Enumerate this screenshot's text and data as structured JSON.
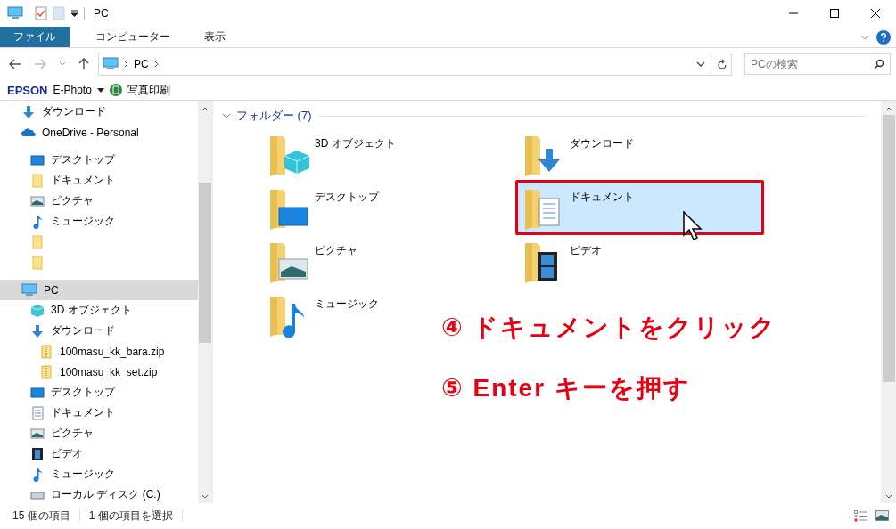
{
  "window": {
    "title": "PC"
  },
  "ribbon": {
    "tabs": [
      {
        "label": "ファイル",
        "selected": true
      },
      {
        "label": "コンピューター",
        "selected": false
      },
      {
        "label": "表示",
        "selected": false
      }
    ]
  },
  "address": {
    "path": [
      "PC"
    ]
  },
  "search": {
    "placeholder": "PCの検索"
  },
  "epson_toolbar": {
    "brand": "EPSON",
    "app": "E-Photo",
    "action": "写真印刷"
  },
  "sidebar": {
    "items": [
      {
        "kind": "download",
        "label": "ダウンロード",
        "selected": false
      },
      {
        "kind": "onedrive",
        "label": "OneDrive - Personal",
        "selected": false,
        "children": [
          {
            "kind": "desktop",
            "label": "デスクトップ",
            "selected": false
          },
          {
            "kind": "folder",
            "label": "ドキュメント",
            "selected": false
          },
          {
            "kind": "pictures",
            "label": "ピクチャ",
            "selected": false
          },
          {
            "kind": "music",
            "label": "ミュージック",
            "selected": false
          },
          {
            "kind": "folder",
            "selected": false
          },
          {
            "kind": "folder",
            "selected": false
          }
        ]
      },
      {
        "kind": "pc",
        "label": "PC",
        "selected": true,
        "children": [
          {
            "kind": "cube",
            "label": "3D オブジェクト",
            "selected": false
          },
          {
            "kind": "download",
            "label": "ダウンロード",
            "selected": false,
            "children": [
              {
                "kind": "zip",
                "label": "100masu_kk_bara.zip",
                "selected": false
              },
              {
                "kind": "zip",
                "label": "100masu_kk_set.zip",
                "selected": false
              }
            ]
          },
          {
            "kind": "desktop",
            "label": "デスクトップ",
            "selected": false
          },
          {
            "kind": "document",
            "label": "ドキュメント",
            "selected": false
          },
          {
            "kind": "pictures",
            "label": "ピクチャ",
            "selected": false
          },
          {
            "kind": "video",
            "label": "ビデオ",
            "selected": false
          },
          {
            "kind": "music",
            "label": "ミュージック",
            "selected": false
          },
          {
            "kind": "drive",
            "label": "ローカル ディスク (C:)",
            "selected": false
          }
        ]
      }
    ]
  },
  "content": {
    "group": {
      "label": "フォルダー (7)",
      "expanded": true
    },
    "folders": [
      {
        "kind": "cube",
        "label": "3D オブジェクト",
        "selected": false
      },
      {
        "kind": "download",
        "label": "ダウンロード",
        "selected": false
      },
      {
        "kind": "desktop",
        "label": "デスクトップ",
        "selected": false
      },
      {
        "kind": "document",
        "label": "ドキュメント",
        "selected": true
      },
      {
        "kind": "pictures",
        "label": "ピクチャ",
        "selected": false
      },
      {
        "kind": "video",
        "label": "ビデオ",
        "selected": false
      },
      {
        "kind": "music",
        "label": "ミュージック",
        "selected": false
      }
    ]
  },
  "annotations": [
    {
      "text": "④ ドキュメントをクリック"
    },
    {
      "text": "⑤ Enter キーを押す"
    }
  ],
  "status_bar": {
    "item_count": "15 個の項目",
    "selection": "1 個の項目を選択"
  }
}
